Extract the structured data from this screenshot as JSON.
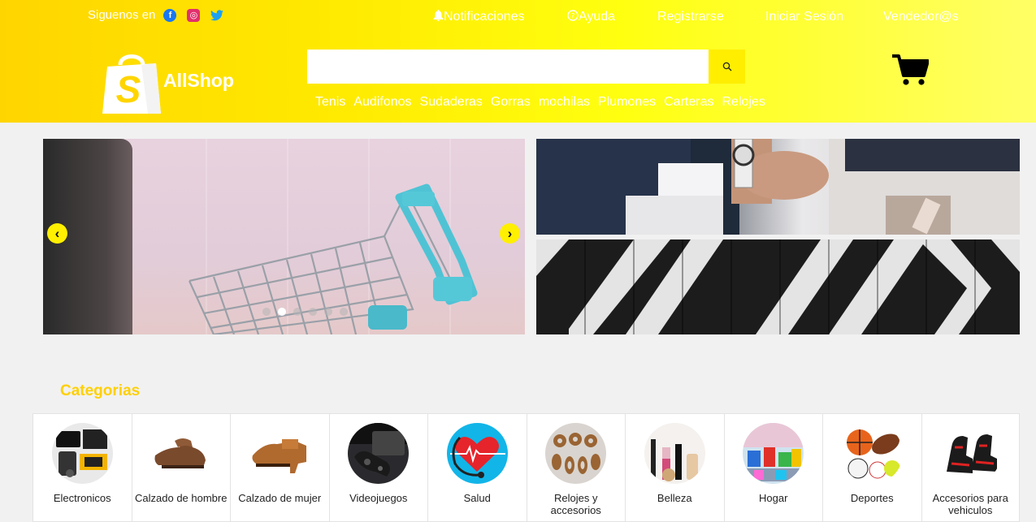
{
  "header": {
    "follow_label": "Siguenos en",
    "social": [
      "facebook-icon",
      "instagram-icon",
      "twitter-icon"
    ],
    "links": {
      "notificaciones": "Notificaciones",
      "ayuda": "Ayuda",
      "registrarse": "Registrarse",
      "iniciar_sesion": "Iniciar Sesión",
      "vendedor": "Vendedor@s"
    },
    "brand": "AllShop",
    "search": {
      "placeholder": "",
      "value": ""
    },
    "nav": [
      "Tenis",
      "Audifonos",
      "Sudaderas",
      "Gorras",
      "mochilas",
      "Plumones",
      "Carteras",
      "Relojes"
    ]
  },
  "carousel": {
    "slides": 6,
    "active_index": 1
  },
  "categories": {
    "title": "Categorias",
    "items": [
      {
        "label": "Electronicos",
        "icon": "electronics-icon"
      },
      {
        "label": "Calzado de hombre",
        "icon": "men-shoe-icon"
      },
      {
        "label": "Calzado de mujer",
        "icon": "women-shoe-icon"
      },
      {
        "label": "Videojuegos",
        "icon": "gamepad-icon"
      },
      {
        "label": "Salud",
        "icon": "health-heart-icon"
      },
      {
        "label": "Relojes y accesorios",
        "icon": "earrings-icon"
      },
      {
        "label": "Belleza",
        "icon": "makeup-icon"
      },
      {
        "label": "Hogar",
        "icon": "home-goods-icon"
      },
      {
        "label": "Deportes",
        "icon": "sports-balls-icon"
      },
      {
        "label": "Accesorios para vehiculos",
        "icon": "car-seat-icon"
      }
    ]
  },
  "colors": {
    "header_start": "#ffd500",
    "header_end": "#ffff66",
    "accent": "#ffd000",
    "button": "#ffee00"
  }
}
